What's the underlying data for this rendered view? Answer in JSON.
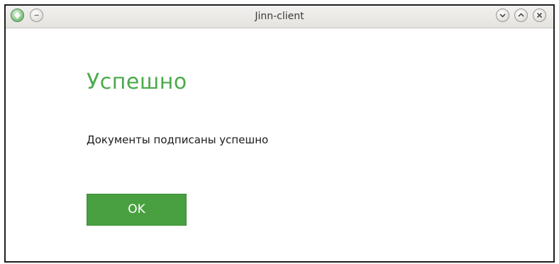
{
  "window": {
    "title": "Jinn-client"
  },
  "titlebar_icons": {
    "app": "app-icon",
    "menu": "menu-icon",
    "minimize": "chevron-down-icon",
    "maximize": "chevron-up-icon",
    "close": "close-icon"
  },
  "dialog": {
    "heading": "Успешно",
    "message": "Документы подписаны успешно",
    "ok_label": "OK"
  },
  "colors": {
    "accent": "#4caa4a",
    "button_bg": "#48a040",
    "button_text": "#ffffff",
    "text": "#1a1a1a"
  }
}
